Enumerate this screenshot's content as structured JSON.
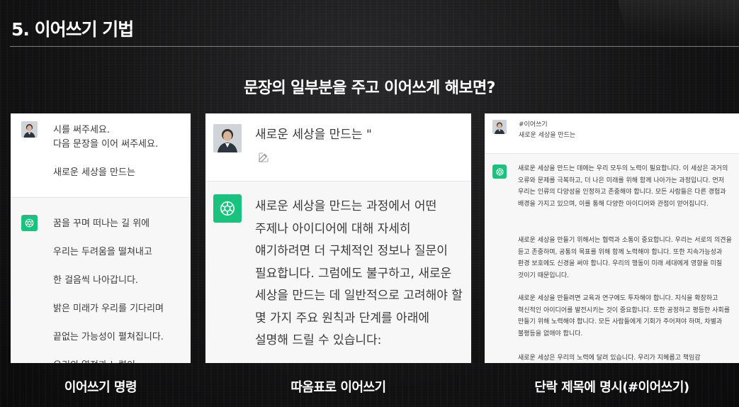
{
  "slide": {
    "section_title": "5. 이어쓰기 기법",
    "headline": "문장의 일부분을 주고 이어쓰게 해보면?"
  },
  "panel1": {
    "caption": "이어쓰기 명령",
    "user_lines": [
      "시를 써주세요.",
      "다음 문장을 이어 써주세요.",
      "새로운 세상을 만드는"
    ],
    "bot_lines": [
      "꿈을 꾸며 떠나는 길 위에",
      "우리는 두려움을 떨쳐내고",
      "한 걸음씩 나아갑니다.",
      "밝은 미래가 우리를 기다리며",
      "끝없는 가능성이 펼쳐집니다.",
      "우리의 열정과 노력이"
    ]
  },
  "panel2": {
    "caption": "따옴표로 이어쓰기",
    "user_prompt": "새로운 세상을 만드는 \"",
    "bot_answer": "새로운 세상을 만드는 과정에서 어떤 주제나 아이디어에 대해 자세히 얘기하려면 더 구체적인 정보나 질문이 필요합니다. 그럼에도 불구하고, 새로운 세상을 만드는 데 일반적으로 고려해야 할 몇 가지 주요 원칙과 단계를 아래에 설명해 드릴 수 있습니다:"
  },
  "panel3": {
    "caption": "단락 제목에 명시(#이어쓰기)",
    "user_title": "#이어쓰기",
    "user_subtitle": "새로운 세상을 만드는",
    "paragraphs": [
      "새로운 세상을 만드는 데에는 우리 모두의 노력이 필요합니다. 이 세상은 과거의 오류와 문제를 극복하고, 더 나은 미래를 위해 함께 나아가는 과정입니다. 먼저 우리는 인류의 다양성을 인정하고 존중해야 합니다. 모든 사람들은 다른 경험과 배경을 가지고 있으며, 이를 통해 다양한 아이디어와 관점이 얻어집니다.",
      "새로운 세상을 만들기 위해서는 협력과 소통이 중요합니다. 우리는 서로의 의견을 듣고 존중하며, 공통의 목표를 위해 함께 노력해야 합니다. 또한 지속가능성과 환경 보호에도 신경을 써야 합니다. 우리의 행동이 미래 세대에게 영향을 미칠 것이기 때문입니다.",
      "새로운 세상을 만들려면 교육과 연구에도 투자해야 합니다. 지식을 확장하고 혁신적인 아이디어를 발전시키는 것이 중요합니다. 또한 공정하고 평등한 사회를 만들기 위해 노력해야 합니다. 모든 사람들에게 기회가 주어져야 하며, 차별과 불평등을 없애야 합니다.",
      "새로운 세상은 우리의 노력에 달려 있습니다. 우리가 지혜롭고 책임감"
    ]
  },
  "colors": {
    "gpt_green": "#19c37d",
    "bot_background": "#f7f7f8"
  },
  "icons": [
    "user-avatar",
    "chatgpt-logo-icon",
    "edit-icon"
  ]
}
